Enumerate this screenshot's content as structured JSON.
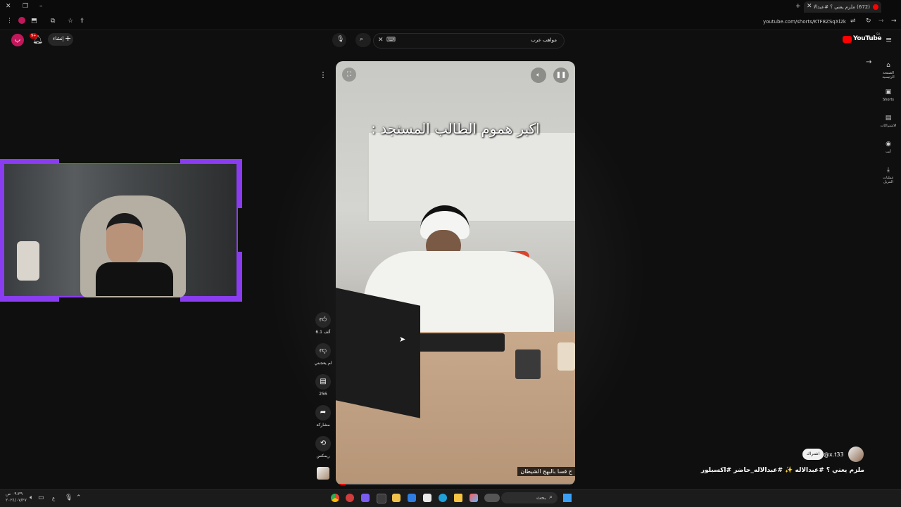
{
  "browser": {
    "tab_title": "(672) ملزم يعني ؟ #عبدالاله ✨",
    "url": "youtube.com/shorts/KTF8ZSqXl2k"
  },
  "youtube": {
    "logo_text": "YouTube",
    "logo_region": "SA",
    "search_value": "مواهب عرب",
    "create_label": "إنشاء",
    "notifications_count": "9+",
    "avatar_letter": "ب"
  },
  "sidebar": {
    "items": [
      {
        "label": "الصفحة الرئيسية",
        "icon": "home-icon"
      },
      {
        "label": "Shorts",
        "icon": "shorts-icon"
      },
      {
        "label": "الاشتراكات",
        "icon": "subscriptions-icon"
      },
      {
        "label": "أنت",
        "icon": "you-icon"
      },
      {
        "label": "عمليات التنزيل",
        "icon": "download-icon"
      }
    ]
  },
  "video": {
    "overlay_text": "اكبر هموم الطالب المستجد :",
    "caption_text": "ج قسا بالبهج الشيطان"
  },
  "actions": {
    "like_count": "6.1 ألف",
    "dislike_label": "لم يعجبني",
    "comments_count": "256",
    "share_label": "مشاركة",
    "remix_label": "ريمكس"
  },
  "channel": {
    "handle": "@x.t33",
    "subscribe_label": "اشتراك",
    "description": "ملزم يعني ؟ #عبدالاله ✨ #عبدالاله_حاضر #اكسبلور"
  },
  "taskbar": {
    "search_placeholder": "بحث",
    "time": "٠٩:٣٩ ص",
    "date": "٢٠٢٤/٠٧/٢٧",
    "lang": "ع"
  },
  "colors": {
    "accent_purple": "#8a3df0",
    "youtube_red": "#ff0000"
  }
}
